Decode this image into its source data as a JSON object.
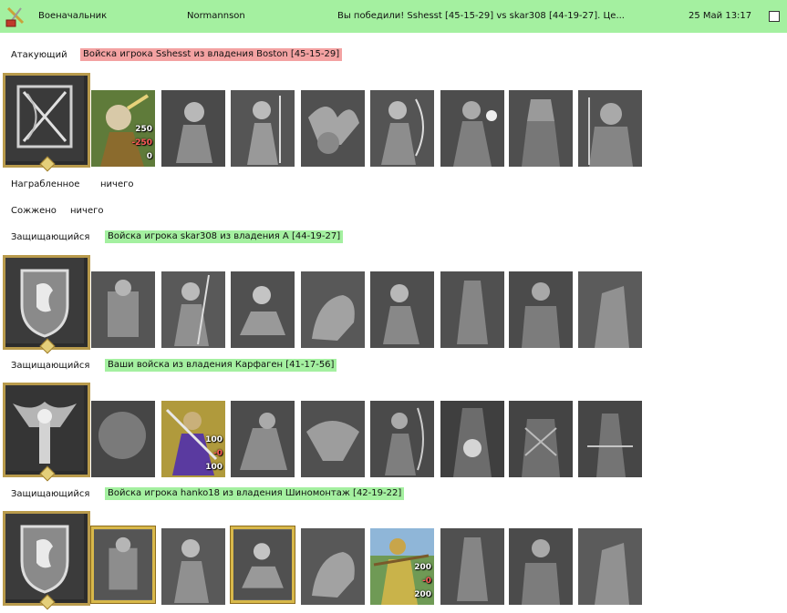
{
  "header": {
    "role": "Военачальник",
    "player": "Normannson",
    "result": "Вы победили! Sshesst [45-15-29] vs skar308 [44-19-27]. Це...",
    "datetime": "25 Май 13:17"
  },
  "attacker": {
    "label": "Атакующий",
    "army": "Войска игрока Sshesst из владения Boston [45-15-29]",
    "counts": [
      "250",
      "-250",
      "0"
    ]
  },
  "loot": {
    "label": "Награбленное",
    "value": "ничего"
  },
  "burned": {
    "label": "Сожжено",
    "value": "ничего"
  },
  "defenders": [
    {
      "label": "Защищающийся",
      "army": "Войска игрока skar308 из владения А [44-19-27]"
    },
    {
      "label": "Защищающийся",
      "army": "Ваши войска из владения Карфаген [41-17-56]",
      "counts": [
        "100",
        "-0",
        "100"
      ]
    },
    {
      "label": "Защищающийся",
      "army": "Войска игрока hanko18 из владения Шиномонтаж [42-19-22]",
      "counts": [
        "200",
        "-0",
        "200"
      ]
    }
  ],
  "icons": {
    "logo": "sword-shield-logo-icon",
    "hero_crests": [
      "bow-crest-icon",
      "lion-shield-crest-icon",
      "demon-crest-icon",
      "lion-shield-crest-icon"
    ]
  },
  "colors": {
    "header_bg": "#a4f0a0",
    "attacker_bg": "#f3a2a2",
    "defender_bg": "#a4f0a0",
    "frame_gold": "#d8b84a"
  }
}
